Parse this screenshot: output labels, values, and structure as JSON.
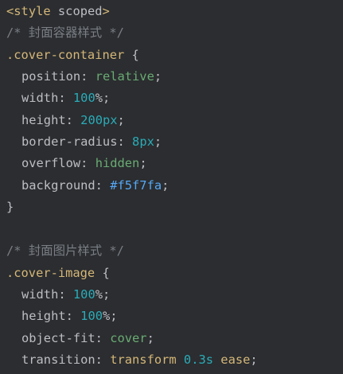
{
  "code": {
    "l1": {
      "open": "<",
      "tag": "style",
      "attr": "scoped",
      "close": ">"
    },
    "l2": {
      "comment": "/* 封面容器样式 */"
    },
    "l3": {
      "selector": ".cover-container",
      "brace": "{"
    },
    "l4": {
      "prop": "position",
      "colon": ":",
      "value": "relative",
      "semi": ";"
    },
    "l5": {
      "prop": "width",
      "colon": ":",
      "num": "100",
      "unit": "%",
      "semi": ";"
    },
    "l6": {
      "prop": "height",
      "colon": ":",
      "num": "200",
      "unit": "px",
      "semi": ";"
    },
    "l7": {
      "prop": "border-radius",
      "colon": ":",
      "num": "8",
      "unit": "px",
      "semi": ";"
    },
    "l8": {
      "prop": "overflow",
      "colon": ":",
      "value": "hidden",
      "semi": ";"
    },
    "l9": {
      "prop": "background",
      "colon": ":",
      "value": "#f5f7fa",
      "semi": ";"
    },
    "l10": {
      "brace": "}"
    },
    "l12": {
      "comment": "/* 封面图片样式 */"
    },
    "l13": {
      "selector": ".cover-image",
      "brace": "{"
    },
    "l14": {
      "prop": "width",
      "colon": ":",
      "num": "100",
      "unit": "%",
      "semi": ";"
    },
    "l15": {
      "prop": "height",
      "colon": ":",
      "num": "100",
      "unit": "%",
      "semi": ";"
    },
    "l16": {
      "prop": "object-fit",
      "colon": ":",
      "value": "cover",
      "semi": ";"
    },
    "l17": {
      "prop": "transition",
      "colon": ":",
      "value": "transform",
      "num": "0.3",
      "unit": "s",
      "extra": "ease",
      "semi": ";"
    }
  },
  "colors": {
    "background": "#2b2d30",
    "tag": "#d5b778",
    "comment": "#7a7e85",
    "keyword_value": "#6aab73",
    "number": "#2aacb8",
    "hex": "#56a8f5",
    "text": "#bcbec4"
  }
}
